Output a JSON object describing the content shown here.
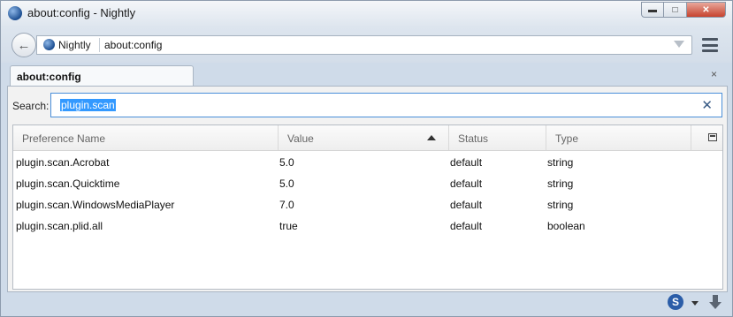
{
  "window": {
    "title": "about:config - Nightly",
    "controls": {
      "minimize": "▬",
      "maximize": "□",
      "close": "✕"
    }
  },
  "navbar": {
    "back_icon": "←",
    "identity_label": "Nightly",
    "url": "about:config"
  },
  "tabs": [
    {
      "label": "about:config"
    }
  ],
  "tabs_close": "×",
  "search": {
    "label": "Search:",
    "value": "plugin.scan",
    "clear_icon": "✕"
  },
  "table": {
    "columns": [
      "Preference Name",
      "Value",
      "Status",
      "Type"
    ],
    "sorted_column": "Value",
    "sort_direction": "ascending",
    "rows": [
      {
        "name": "plugin.scan.Acrobat",
        "value": "5.0",
        "status": "default",
        "type": "string"
      },
      {
        "name": "plugin.scan.Quicktime",
        "value": "5.0",
        "status": "default",
        "type": "string"
      },
      {
        "name": "plugin.scan.WindowsMediaPlayer",
        "value": "7.0",
        "status": "default",
        "type": "string"
      },
      {
        "name": "plugin.scan.plid.all",
        "value": "true",
        "status": "default",
        "type": "boolean"
      }
    ]
  },
  "bottombar": {
    "s_label": "S"
  },
  "colors": {
    "window_frame": "#cfdbe9",
    "selection": "#3399ff",
    "search_focus": "#4a8fd9",
    "close_button": "#c7432e"
  }
}
